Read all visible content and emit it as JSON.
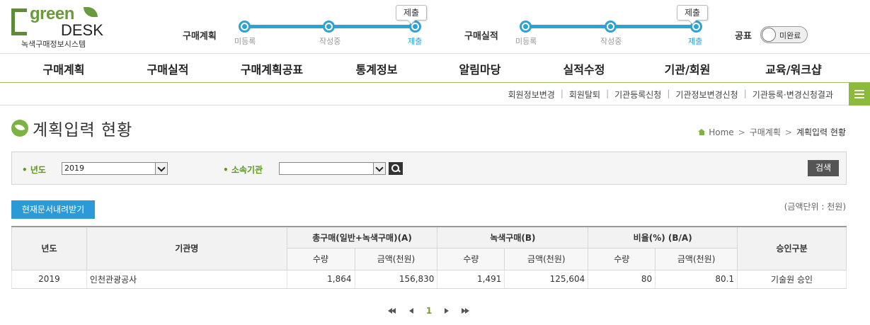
{
  "logo": {
    "line1": "green",
    "line2": "DESK",
    "subtitle": "녹색구매정보시스템"
  },
  "progress": {
    "plan": {
      "title": "구매계획",
      "steps": [
        "미등록",
        "작성중",
        "제출"
      ],
      "bubble": "제출"
    },
    "result": {
      "title": "구매실적",
      "steps": [
        "미등록",
        "작성중",
        "제출"
      ],
      "bubble": "제출"
    },
    "publish": {
      "title": "공표",
      "toggle_label": "미완료"
    }
  },
  "nav": {
    "items": [
      "구매계획",
      "구매실적",
      "구매계획공표",
      "통계정보",
      "알림마당",
      "실적수정",
      "기관/회원",
      "교육/워크샵"
    ]
  },
  "subnav": {
    "links": [
      "회원정보변경",
      "회원탈퇴",
      "기관등록신청",
      "기관정보변경신청",
      "기관등록·변경신청결과"
    ]
  },
  "page": {
    "title": "계획입력 현황",
    "breadcrumb": [
      "Home",
      "구매계획",
      "계획입력 현황"
    ]
  },
  "search": {
    "year_label": "년도",
    "year_value": "2019",
    "org_label": "소속기관",
    "org_value": "",
    "search_button": "검색"
  },
  "download_button": "현재문서내려받기",
  "unit_note": "(금액단위 : 천원)",
  "table": {
    "headers": {
      "year": "년도",
      "org": "기관명",
      "total": "총구매(일반+녹색구매)(A)",
      "green": "녹색구매(B)",
      "ratio": "비율(%) (B/A)",
      "approval": "승인구분",
      "qty": "수량",
      "amount": "금액(천원)"
    },
    "rows": [
      {
        "year": "2019",
        "org": "인천관광공사",
        "total_qty": "1,864",
        "total_amt": "156,830",
        "green_qty": "1,491",
        "green_amt": "125,604",
        "ratio_qty": "80",
        "ratio_amt": "80.1",
        "approval": "기술원 승인"
      }
    ]
  },
  "pager": {
    "current": "1"
  }
}
